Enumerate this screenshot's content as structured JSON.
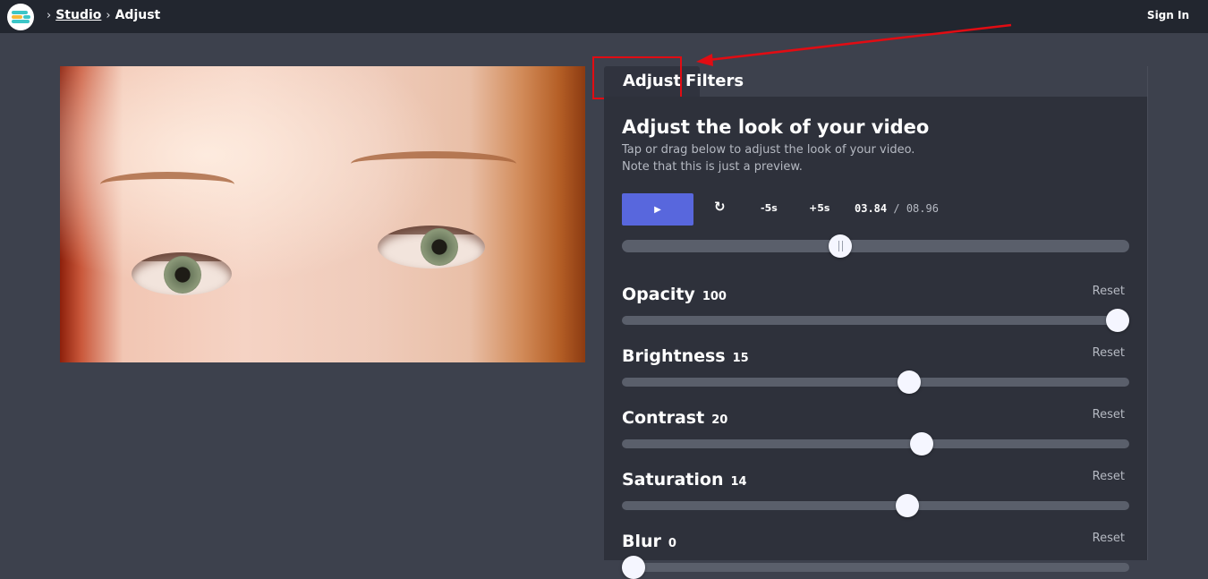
{
  "header": {
    "breadcrumb": [
      {
        "label": "Studio"
      },
      {
        "label": "Adjust"
      }
    ],
    "breadcrumb_separator": "›",
    "sign_in_label": "Sign In"
  },
  "tabs": [
    {
      "label": "Adjust",
      "active": true
    },
    {
      "label": "Filters",
      "active": false
    }
  ],
  "panel": {
    "title": "Adjust the look of your video",
    "subtitle_line1": "Tap or drag below to adjust the look of your video.",
    "subtitle_line2": "Note that this is just a preview.",
    "player": {
      "play_icon": "▶",
      "replay_icon": "↻",
      "back_label": "-5s",
      "forward_label": "+5s",
      "current_time": "03.84",
      "time_separator": "/",
      "total_time": "08.96",
      "progress_fraction": 0.427
    },
    "reset_label": "Reset",
    "sliders": [
      {
        "label": "Opacity",
        "value": "100",
        "fraction": 1.0
      },
      {
        "label": "Brightness",
        "value": "15",
        "fraction": 0.57
      },
      {
        "label": "Contrast",
        "value": "20",
        "fraction": 0.595
      },
      {
        "label": "Saturation",
        "value": "14",
        "fraction": 0.565
      },
      {
        "label": "Blur",
        "value": "0",
        "fraction": 0.0
      }
    ]
  },
  "colors": {
    "accent": "#5867dd",
    "highlight": "#e10c13",
    "background": "#3d414d",
    "topbar": "#22262f",
    "panel": "#2e313b"
  }
}
